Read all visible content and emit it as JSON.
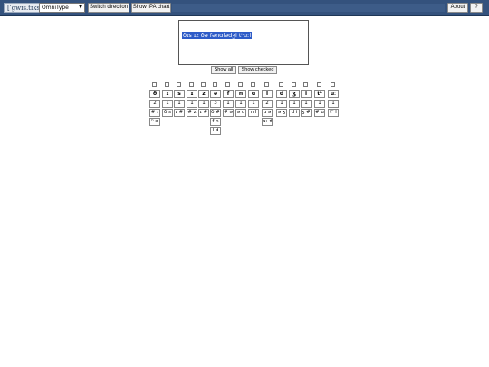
{
  "toolbar": {
    "brand": "[ˈɡwɪs.tɪks]",
    "input_method": "OmniType",
    "switch_direction": "Switch direction",
    "show_ipa_chart": "Show IPA chart",
    "about": "About",
    "help": "?"
  },
  "editor": {
    "text": "ðɪs ɪz ðə fənɑlədʒi tʰuːl"
  },
  "controls": {
    "show_all": "Show all",
    "show_checked": "Show checked"
  },
  "phonemes": [
    {
      "symbol": "ð",
      "count": "2",
      "contexts": [
        "# ɪ",
        "ʰ ə"
      ]
    },
    {
      "symbol": "ɪ",
      "count": "1",
      "contexts": [
        "ð s"
      ]
    },
    {
      "symbol": "s",
      "count": "1",
      "contexts": [
        "ɪ #"
      ]
    },
    {
      "symbol": "ɪ",
      "count": "1",
      "contexts": [
        "# z"
      ]
    },
    {
      "symbol": "z",
      "count": "1",
      "contexts": [
        "ɪ #"
      ]
    },
    {
      "symbol": "ə",
      "count": "3",
      "contexts": [
        "ð #",
        "f n",
        "l d"
      ]
    },
    {
      "symbol": "f",
      "count": "1",
      "contexts": [
        "# ə"
      ]
    },
    {
      "symbol": "n",
      "count": "1",
      "contexts": [
        "ə ɑ"
      ]
    },
    {
      "symbol": "ɑ",
      "count": "1",
      "contexts": [
        "n l"
      ]
    },
    {
      "symbol": "l",
      "count": "2",
      "contexts": [
        "ɑ ə",
        "uː #"
      ]
    },
    {
      "symbol": "d",
      "count": "1",
      "contexts": [
        "ə ʒ"
      ]
    },
    {
      "symbol": "ʒ",
      "count": "1",
      "contexts": [
        "d i"
      ]
    },
    {
      "symbol": "i",
      "count": "1",
      "contexts": [
        "ʒ #"
      ]
    },
    {
      "symbol": "tʰ",
      "count": "1",
      "contexts": [
        "# uː"
      ]
    },
    {
      "symbol": "uː",
      "count": "1",
      "contexts": [
        "tʰ l"
      ]
    }
  ]
}
